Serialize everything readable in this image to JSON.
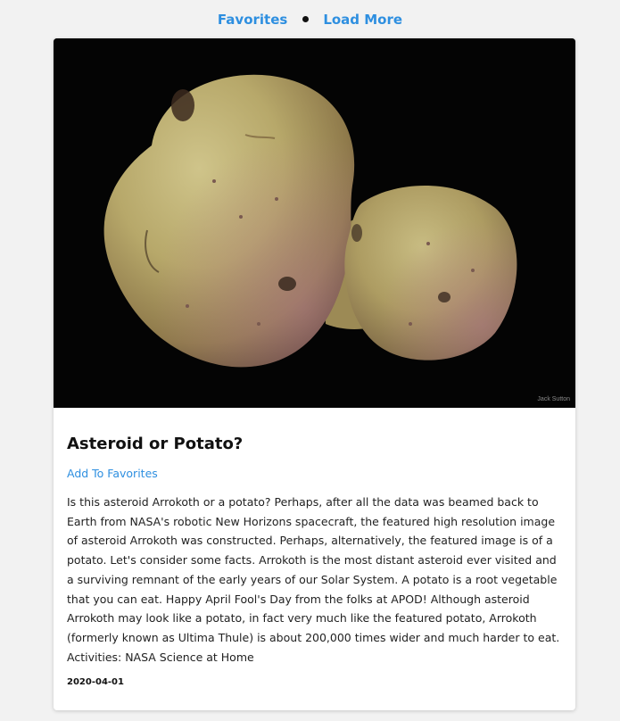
{
  "nav": {
    "favorites_label": "Favorites",
    "load_more_label": "Load More"
  },
  "apod": {
    "image_credit": "Jack Sutton",
    "title": "Asteroid or Potato?",
    "add_favorites_label": "Add To Favorites",
    "explanation": "Is this asteroid Arrokoth or a potato? Perhaps, after all the data was beamed back to Earth from NASA's robotic New Horizons spacecraft, the featured high resolution image of asteroid Arrokoth was constructed. Perhaps, alternatively, the featured image is of a potato. Let's consider some facts. Arrokoth is the most distant asteroid ever visited and a surviving remnant of the early years of our Solar System. A potato is a root vegetable that you can eat. Happy April Fool's Day from the folks at APOD! Although asteroid Arrokoth may look like a potato, in fact very much like the featured potato, Arrokoth (formerly known as Ultima Thule) is about 200,000 times wider and much harder to eat. Activities: NASA Science at Home",
    "date": "2020-04-01"
  },
  "colors": {
    "link": "#2e8fe0",
    "page_background": "#f2f2f2",
    "card_background": "#ffffff",
    "photo_background": "#040404"
  }
}
